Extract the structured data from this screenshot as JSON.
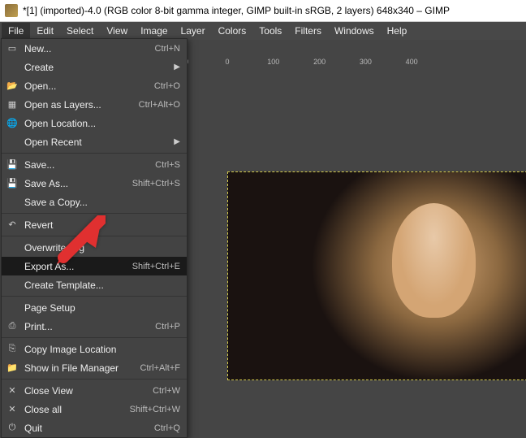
{
  "title": "*[1] (imported)-4.0 (RGB color 8-bit gamma integer, GIMP built-in sRGB, 2 layers) 648x340 – GIMP",
  "menubar": [
    "File",
    "Edit",
    "Select",
    "View",
    "Image",
    "Layer",
    "Colors",
    "Tools",
    "Filters",
    "Windows",
    "Help"
  ],
  "ruler": {
    "ticks": [
      0,
      100,
      200,
      300,
      400
    ],
    "offset": 280
  },
  "file_menu": {
    "groups": [
      [
        {
          "icon": "doc",
          "label": "New...",
          "sc": "Ctrl+N"
        },
        {
          "icon": "",
          "label": "Create",
          "sc": "",
          "sub": "▶"
        },
        {
          "icon": "open",
          "label": "Open...",
          "sc": "Ctrl+O"
        },
        {
          "icon": "layers",
          "label": "Open as Layers...",
          "sc": "Ctrl+Alt+O"
        },
        {
          "icon": "globe",
          "label": "Open Location...",
          "sc": ""
        },
        {
          "icon": "",
          "label": "Open Recent",
          "sc": "",
          "sub": "▶"
        }
      ],
      [
        {
          "icon": "save",
          "label": "Save...",
          "sc": "Ctrl+S"
        },
        {
          "icon": "saveas",
          "label": "Save As...",
          "sc": "Shift+Ctrl+S"
        },
        {
          "icon": "",
          "label": "Save a Copy...",
          "sc": ""
        }
      ],
      [
        {
          "icon": "revert",
          "label": "Revert",
          "sc": ""
        }
      ],
      [
        {
          "icon": "",
          "label": "Overwrite     .jpg",
          "sc": ""
        },
        {
          "icon": "",
          "label": "Export As...",
          "sc": "Shift+Ctrl+E",
          "hi": true
        },
        {
          "icon": "",
          "label": "Create Template...",
          "sc": ""
        }
      ],
      [
        {
          "icon": "",
          "label": "Page Setup",
          "sc": ""
        },
        {
          "icon": "print",
          "label": "Print...",
          "sc": "Ctrl+P"
        }
      ],
      [
        {
          "icon": "copy",
          "label": "Copy Image Location",
          "sc": ""
        },
        {
          "icon": "folder",
          "label": "Show in File Manager",
          "sc": "Ctrl+Alt+F"
        }
      ],
      [
        {
          "icon": "x",
          "label": "Close View",
          "sc": "Ctrl+W"
        },
        {
          "icon": "xx",
          "label": "Close all",
          "sc": "Shift+Ctrl+W"
        },
        {
          "icon": "quit",
          "label": "Quit",
          "sc": "Ctrl+Q"
        }
      ]
    ]
  }
}
